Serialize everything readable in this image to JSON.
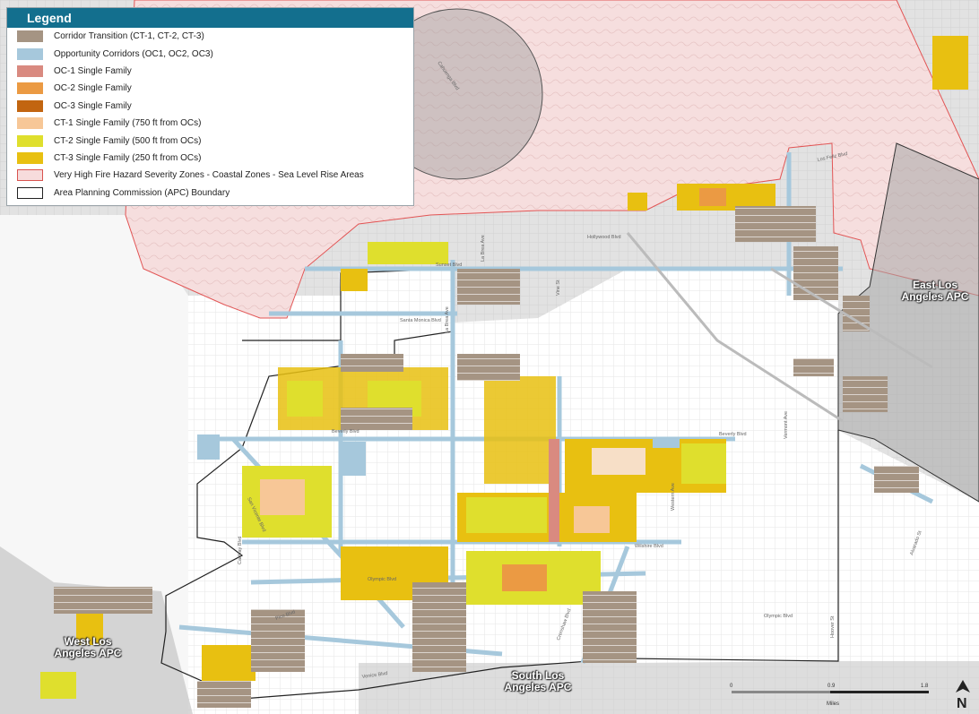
{
  "legend": {
    "title": "Legend",
    "items": [
      {
        "label": "Corridor Transition (CT-1, CT-2, CT-3)",
        "color": "#a59483",
        "name": "legend-corridor-transition"
      },
      {
        "label": "Opportunity Corridors (OC1, OC2, OC3)",
        "color": "#a6c8dc",
        "name": "legend-opportunity-corridors"
      },
      {
        "label": "OC-1 Single Family",
        "color": "#d98a80",
        "name": "legend-oc1-single-family"
      },
      {
        "label": "OC-2 Single Family",
        "color": "#eb9a43",
        "name": "legend-oc2-single-family"
      },
      {
        "label": "OC-3 Single Family",
        "color": "#c26510",
        "name": "legend-oc3-single-family"
      },
      {
        "label": "CT-1 Single Family (750 ft from OCs)",
        "color": "#f7c797",
        "name": "legend-ct1-single-family"
      },
      {
        "label": "CT-2 Single Family (500 ft from OCs)",
        "color": "#dfdf2d",
        "name": "legend-ct2-single-family"
      },
      {
        "label": "CT-3 Single Family (250 ft from OCs)",
        "color": "#e8c011",
        "name": "legend-ct3-single-family"
      },
      {
        "label": "Very High Fire Hazard Severity Zones - Coastal Zones - Sea Level Rise Areas",
        "color": "#f7dcdc",
        "border": "#d9534f",
        "name": "legend-fire-hazard"
      },
      {
        "label": "Area Planning Commission (APC) Boundary",
        "color": "#ffffff",
        "border": "#222222",
        "name": "legend-apc-boundary"
      }
    ]
  },
  "apc_labels": {
    "east": "East Los Angeles APC",
    "west": "West Los Angeles APC",
    "south": "South Los Angeles APC"
  },
  "streets": {
    "cahuenga": "Cahuenga Blvd",
    "los_feliz": "Los Feliz Blvd",
    "hollywood": "Hollywood Blvd",
    "sunset": "Sunset Blvd",
    "la_brea_north": "La Brea Ave",
    "santa_monica": "Santa Monica Blvd",
    "la_brea_south": "La Brea Ave",
    "vine": "Vine St",
    "beverly_west": "Beverly Blvd",
    "beverly_east": "Beverly Blvd",
    "vermont": "Vermont Ave",
    "san_vicente": "San Vicente Blvd",
    "carthay": "Carthay Blvd",
    "olympic_west": "Olympic Blvd",
    "venice": "Venice Blvd",
    "wilshire": "Wilshire Blvd",
    "western": "Western Ave",
    "olympic_east": "Olympic Blvd",
    "hoover": "Hoover St",
    "alvarado": "Alvarado St",
    "crenshaw": "Crenshaw Blvd",
    "pico": "Pico Blvd"
  },
  "scale": {
    "ticks": [
      "0",
      "0.9",
      "1.8"
    ],
    "unit": "Miles"
  },
  "north_arrow": "N",
  "colors": {
    "fire_zone": "#f6dede",
    "fire_zone_border": "#e25555",
    "apc_outside": "#e4e4e4",
    "street_grid": "#eeeeee",
    "hills": "#e8d0d0"
  }
}
